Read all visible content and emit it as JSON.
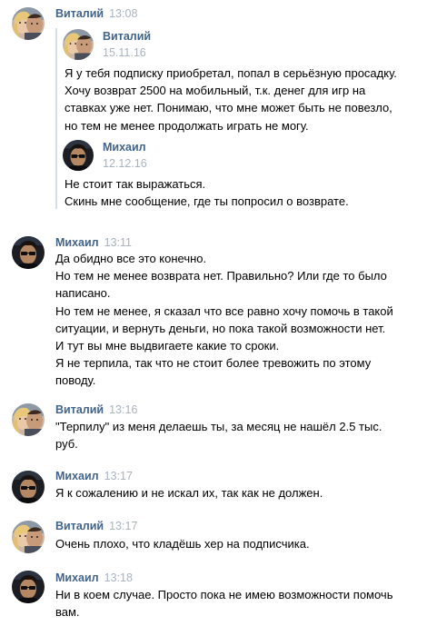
{
  "icons": {
    "vitaly_avatar": "avatar-vitaly-icon",
    "mikhail_avatar": "avatar-mikhail-icon"
  },
  "colors": {
    "name": "#42648b",
    "time": "#a8b3bf",
    "forward_bar": "#d7dee6"
  },
  "messages": [
    {
      "author": "Виталий",
      "time": "13:08",
      "forwarded": [
        {
          "author": "Виталий",
          "date": "15.11.16",
          "lines": [
            "Я у тебя подписку приобретал, попал в серьёзную просадку.",
            "Хочу возврат 2500 на мобильный, т.к. денег для игр на",
            "ставках уже нет. Понимаю, что мне может быть не повезло,",
            "но тем не менее продолжать играть не могу."
          ]
        },
        {
          "author": "Михаил",
          "date": "12.12.16",
          "lines": [
            "Не стоит так выражаться.",
            "Скинь мне сообщение, где ты попросил о возврате."
          ]
        }
      ]
    },
    {
      "author": "Михаил",
      "time": "13:11",
      "lines": [
        "Да обидно все это конечно.",
        "Но тем не менее возврата нет. Правильно? Или где то было",
        "написано.",
        "Но тем не менее, я сказал что все равно хочу помочь в такой",
        "ситуации, и вернуть деньги, но пока такой возможности нет.",
        "И тут вы мне выдвигаете какие то сроки.",
        "Я не терпила, так что не стоит более тревожить по этому",
        "поводу."
      ]
    },
    {
      "author": "Виталий",
      "time": "13:16",
      "lines": [
        "\"Терпилу\" из меня делаешь ты, за месяц не нашёл 2.5 тыс.",
        "руб."
      ]
    },
    {
      "author": "Михаил",
      "time": "13:17",
      "lines": [
        "Я к сожалению и не искал их, так как не должен."
      ]
    },
    {
      "author": "Виталий",
      "time": "13:17",
      "lines": [
        "Очень плохо, что кладёшь хер на подписчика."
      ]
    },
    {
      "author": "Михаил",
      "time": "13:18",
      "lines": [
        "Ни в коем случае. Просто пока не имею возможности помочь",
        "вам."
      ]
    }
  ]
}
